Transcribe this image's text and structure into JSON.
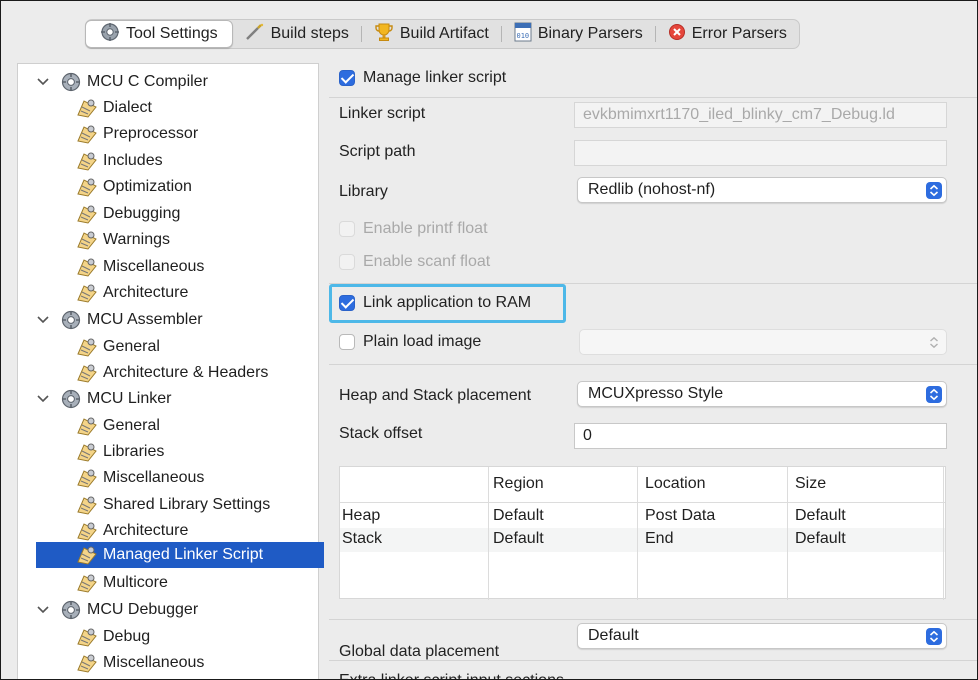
{
  "tabs": [
    {
      "label": "Tool Settings",
      "icon": "gear-icon",
      "active": true
    },
    {
      "label": "Build steps",
      "icon": "wand-icon",
      "active": false
    },
    {
      "label": "Build Artifact",
      "icon": "trophy-icon",
      "active": false
    },
    {
      "label": "Binary Parsers",
      "icon": "binary-file-icon",
      "active": false
    },
    {
      "label": "Error Parsers",
      "icon": "error-icon",
      "active": false
    }
  ],
  "tree": {
    "groups": [
      {
        "label": "MCU C Compiler",
        "items": [
          "Dialect",
          "Preprocessor",
          "Includes",
          "Optimization",
          "Debugging",
          "Warnings",
          "Miscellaneous",
          "Architecture"
        ]
      },
      {
        "label": "MCU Assembler",
        "items": [
          "General",
          "Architecture & Headers"
        ]
      },
      {
        "label": "MCU Linker",
        "items": [
          "General",
          "Libraries",
          "Miscellaneous",
          "Shared Library Settings",
          "Architecture",
          "Managed Linker Script",
          "Multicore"
        ]
      },
      {
        "label": "MCU Debugger",
        "items": [
          "Debug",
          "Miscellaneous"
        ]
      }
    ],
    "selected": "Managed Linker Script"
  },
  "settings": {
    "manage_linker_script": {
      "label": "Manage linker script",
      "checked": true
    },
    "linker_script": {
      "label": "Linker script",
      "value": "evkbmimxrt1170_iled_blinky_cm7_Debug.ld"
    },
    "script_path": {
      "label": "Script path",
      "value": ""
    },
    "library": {
      "label": "Library",
      "value": "Redlib (nohost-nf)"
    },
    "enable_printf_float": {
      "label": "Enable printf float",
      "checked": false,
      "enabled": false
    },
    "enable_scanf_float": {
      "label": "Enable scanf float",
      "checked": false,
      "enabled": false
    },
    "link_app_to_ram": {
      "label": "Link application to RAM",
      "checked": true
    },
    "plain_load_image": {
      "label": "Plain load image",
      "checked": false
    },
    "heap_stack_placement": {
      "label": "Heap and Stack placement",
      "value": "MCUXpresso Style"
    },
    "stack_offset": {
      "label": "Stack offset",
      "value": "0"
    },
    "global_data_placement": {
      "label": "Global data placement",
      "value": "Default"
    },
    "extra_section_label": "Extra linker script input sections"
  },
  "memory_table": {
    "columns": [
      "",
      "Region",
      "Location",
      "Size"
    ],
    "rows": [
      [
        "Heap",
        "Default",
        "Post Data",
        "Default"
      ],
      [
        "Stack",
        "Default",
        "End",
        "Default"
      ]
    ]
  },
  "colors": {
    "selection": "#1f5bc5",
    "checkbox_accent": "#2d6cdf",
    "highlight_border": "#4db8e8"
  }
}
